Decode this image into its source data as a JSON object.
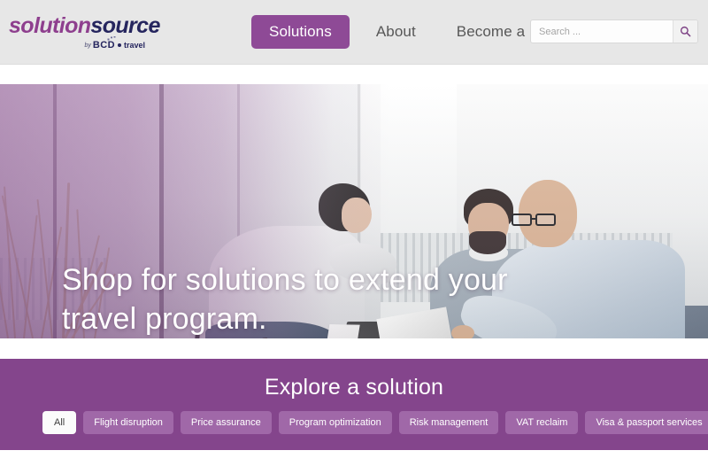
{
  "header": {
    "logo": {
      "text_part_1": "solution",
      "text_part_2": "source",
      "tagline_by": "by",
      "tagline_brand": "BCD",
      "tagline_word": "travel"
    },
    "nav": [
      {
        "label": "Solutions",
        "active": true
      },
      {
        "label": "About",
        "active": false
      },
      {
        "label": "Become a partner",
        "active": false
      }
    ],
    "search": {
      "placeholder": "Search ...",
      "value": "",
      "icon": "search-icon",
      "button_label": ""
    },
    "background_color": "#e7e7e7"
  },
  "hero": {
    "title": "Shop for solutions to extend your travel program.",
    "overlay_color": "#7a3a80",
    "text_color": "#ffffff"
  },
  "explore": {
    "title": "Explore a solution",
    "background_color": "#84458c",
    "filters": [
      {
        "label": "All",
        "active": true
      },
      {
        "label": "Flight disruption",
        "active": false
      },
      {
        "label": "Price assurance",
        "active": false
      },
      {
        "label": "Program optimization",
        "active": false
      },
      {
        "label": "Risk management",
        "active": false
      },
      {
        "label": "VAT reclaim",
        "active": false
      },
      {
        "label": "Visa & passport services",
        "active": false
      }
    ],
    "pill_color": "#a068a8",
    "pill_active_color": "#fbfbfb"
  },
  "colors": {
    "brand_purple": "#8e4a96",
    "brand_navy": "#25255e",
    "logo_purple": "#8e3f8e"
  }
}
